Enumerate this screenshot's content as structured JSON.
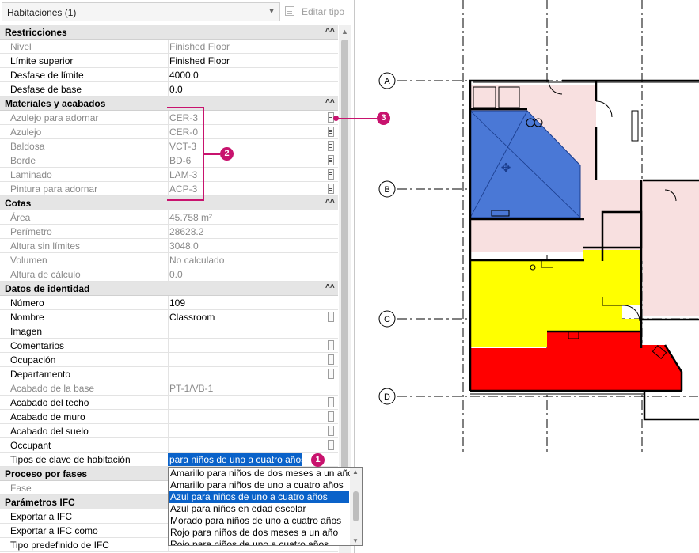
{
  "header": {
    "type_selector": "Habitaciones (1)",
    "edit_type": "Editar tipo"
  },
  "groups": {
    "restricciones": "Restricciones",
    "materiales": "Materiales y acabados",
    "cotas": "Cotas",
    "identidad": "Datos de identidad",
    "fases": "Proceso por fases",
    "ifc": "Parámetros IFC"
  },
  "restricciones": [
    {
      "name": "Nivel",
      "value": "Finished Floor"
    },
    {
      "name": "Límite superior",
      "value": "Finished Floor"
    },
    {
      "name": "Desfase de límite",
      "value": "4000.0"
    },
    {
      "name": "Desfase de base",
      "value": "0.0"
    }
  ],
  "materiales": [
    {
      "name": "Azulejo para adornar",
      "value": "CER-3"
    },
    {
      "name": "Azulejo",
      "value": "CER-0"
    },
    {
      "name": "Baldosa",
      "value": "VCT-3"
    },
    {
      "name": "Borde",
      "value": "BD-6"
    },
    {
      "name": "Laminado",
      "value": "LAM-3"
    },
    {
      "name": "Pintura para adornar",
      "value": "ACP-3"
    }
  ],
  "cotas": [
    {
      "name": "Área",
      "value": "45.758 m²"
    },
    {
      "name": "Perímetro",
      "value": "28628.2"
    },
    {
      "name": "Altura sin límites",
      "value": "3048.0"
    },
    {
      "name": "Volumen",
      "value": "No calculado"
    },
    {
      "name": "Altura de cálculo",
      "value": "0.0"
    }
  ],
  "identidad": [
    {
      "name": "Número",
      "value": "109"
    },
    {
      "name": "Nombre",
      "value": "Classroom"
    },
    {
      "name": "Imagen",
      "value": ""
    },
    {
      "name": "Comentarios",
      "value": ""
    },
    {
      "name": "Ocupación",
      "value": ""
    },
    {
      "name": "Departamento",
      "value": ""
    },
    {
      "name": "Acabado de la base",
      "value": "PT-1/VB-1"
    },
    {
      "name": "Acabado del techo",
      "value": ""
    },
    {
      "name": "Acabado de muro",
      "value": ""
    },
    {
      "name": "Acabado del suelo",
      "value": ""
    },
    {
      "name": "Occupant",
      "value": ""
    },
    {
      "name": "Tipos de clave de habitación",
      "value": "para niños de uno a cuatro años"
    }
  ],
  "fases": [
    {
      "name": "Fase",
      "value": ""
    }
  ],
  "ifc": [
    {
      "name": "Exportar a IFC",
      "value": ""
    },
    {
      "name": "Exportar a IFC como",
      "value": ""
    },
    {
      "name": "Tipo predefinido de IFC",
      "value": ""
    }
  ],
  "dropdown": {
    "options": [
      "Amarillo para niños de dos meses a un año",
      "Amarillo para niños de uno a cuatro años",
      "Azul para niños de uno a cuatro años",
      "Azul para niños en edad escolar",
      "Morado para niños de uno a cuatro años",
      "Rojo para niños de dos meses a un año",
      "Rojo para niños de uno a cuatro años"
    ],
    "selected_index": 2
  },
  "callouts": {
    "c1": "1",
    "c2": "2",
    "c3": "3"
  },
  "grid_labels": [
    "A",
    "B",
    "C",
    "D"
  ],
  "colors": {
    "accent": "#c8136e",
    "selection": "#0a62c9",
    "room_blue": "#4a78d6",
    "room_yellow": "#ffff00",
    "room_red": "#ff0000",
    "room_pink": "#f8e0e0"
  },
  "icons": [
    "chevron-down-icon",
    "edit-type-icon",
    "collapse-icon",
    "scroll-up-icon",
    "scroll-down-icon",
    "browse-button-icon",
    "move-cross-icon"
  ]
}
